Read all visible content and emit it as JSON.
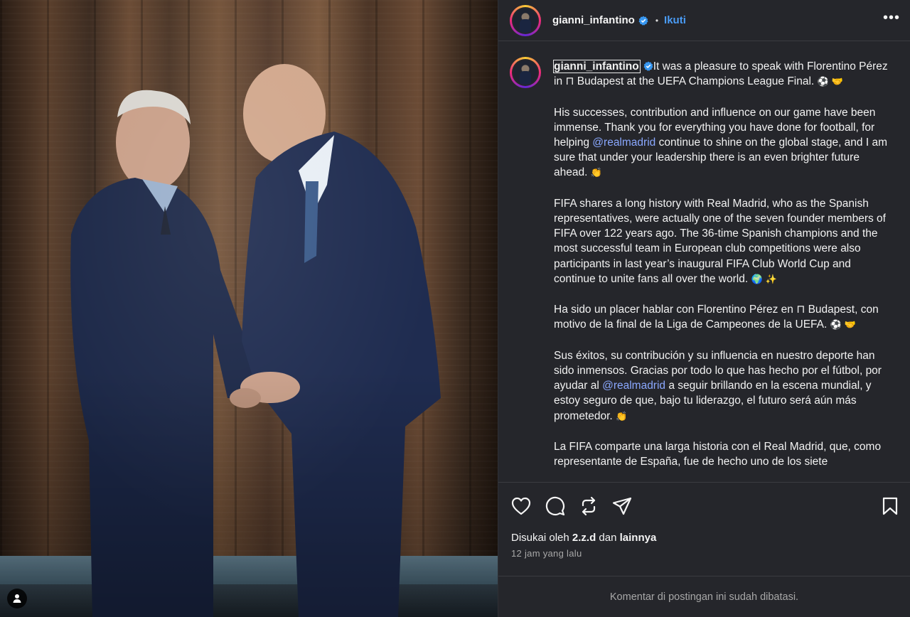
{
  "post": {
    "username": "gianni_infantino",
    "follow_label": "Ikuti",
    "separator": "•",
    "more_label": "•••"
  },
  "caption": {
    "username": "gianni_infantino",
    "p1_text": "It was a pleasure to speak with Florentino Pérez in ⊓ Budapest at the UEFA Champions League Final. ",
    "p1_emoji": "⚽ 🤝",
    "p2_a": "His successes, contribution and influence on our game have been immense. Thank you for everything you have done for football, for helping ",
    "p2_mention": "@realmadrid",
    "p2_b": " continue to shine on the global stage, and I am sure that under your leadership there is an even brighter future ahead. ",
    "p2_emoji": "👏",
    "p3_text": "FIFA shares a long history with Real Madrid, who as the Spanish representatives, were actually one of the seven founder members of FIFA over 122 years ago. The 36-time Spanish champions and the most successful team in European club competitions were also participants in last year’s inaugural FIFA Club World Cup and continue to unite fans all over the world. ",
    "p3_emoji": "🌍 ✨",
    "p4_text": "Ha sido un placer hablar con Florentino Pérez en ⊓ Budapest, con motivo de la final de la Liga de Campeones de la UEFA. ",
    "p4_emoji": "⚽ 🤝",
    "p5_a": "Sus éxitos, su contribución y su influencia en nuestro deporte han sido inmensos. Gracias por todo lo que has hecho por el fútbol, por ayudar al ",
    "p5_mention": "@realmadrid",
    "p5_b": " a seguir brillando en la escena mundial, y estoy seguro de que, bajo tu liderazgo, el futuro será aún más prometedor. ",
    "p5_emoji": "👏",
    "p6_text": "La FIFA comparte una larga historia con el Real Madrid, que, como representante de España, fue de hecho uno de los siete"
  },
  "engagement": {
    "liked_by_prefix": "Disukai oleh ",
    "liked_by_user": "2.z.d",
    "liked_by_middle": " dan ",
    "liked_by_others": "lainnya",
    "timestamp": "12 jam yang lalu"
  },
  "comments": {
    "restricted_notice": "Komentar di postingan ini sudah dibatasi."
  },
  "icons": [
    "heart-icon",
    "comment-icon",
    "repost-icon",
    "share-icon",
    "bookmark-icon",
    "verified-icon",
    "user-tag-icon"
  ],
  "colors": {
    "panel_bg": "#25262b",
    "follow_blue": "#4a9cf6",
    "mention_blue": "#8aa8ff",
    "verified_blue": "#3897f0"
  }
}
